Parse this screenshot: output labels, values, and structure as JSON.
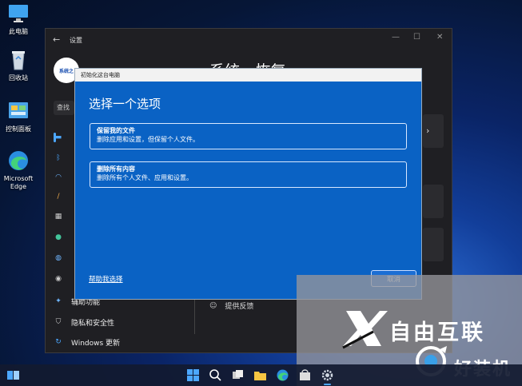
{
  "desktop": {
    "icons": [
      {
        "label": "此电脑"
      },
      {
        "label": "回收站"
      },
      {
        "label": "控制面板"
      },
      {
        "label": "Microsoft Edge"
      }
    ]
  },
  "settings": {
    "title": "设置",
    "breadcrumb": "系统 › 恢复",
    "search_prefix": "查找",
    "avatar_text": "系统之",
    "nav": [
      {
        "label": ""
      },
      {
        "label": ""
      },
      {
        "label": ""
      },
      {
        "label": ""
      },
      {
        "label": ""
      },
      {
        "label": ""
      },
      {
        "label": ""
      },
      {
        "label": ""
      },
      {
        "label": "辅助功能"
      },
      {
        "label": "隐私和安全性"
      },
      {
        "label": "Windows 更新"
      }
    ],
    "feedback_label": "提供反馈"
  },
  "dialog": {
    "title": "初始化这台电脑",
    "heading": "选择一个选项",
    "options": [
      {
        "title": "保留我的文件",
        "desc": "删除应用和设置，但保留个人文件。"
      },
      {
        "title": "删除所有内容",
        "desc": "删除所有个人文件、应用和设置。"
      }
    ],
    "help_link": "帮助我选择",
    "cancel": "取消"
  },
  "watermark": {
    "brand1": "自由互联",
    "brand2": "好装机"
  },
  "colors": {
    "dialog_bg": "#0a62c4",
    "accent": "#4ca7ff",
    "settings_bg": "#1f1f23"
  }
}
